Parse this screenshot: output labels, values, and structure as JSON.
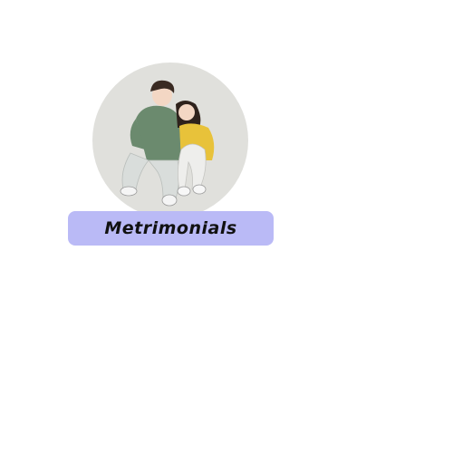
{
  "brand": {
    "name": "Metrimonials"
  },
  "colors": {
    "circle": "#e0e0dc",
    "banner": "#babaf6",
    "text": "#111111",
    "sweater_man": "#6b8a6e",
    "sweater_woman": "#e8c23a"
  }
}
